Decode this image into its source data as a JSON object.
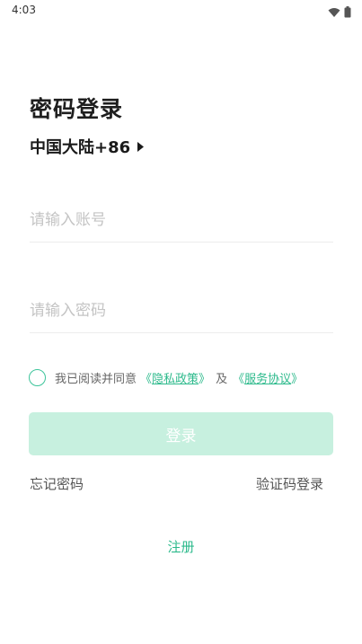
{
  "status_bar": {
    "time": "4:03",
    "icons": [
      "wifi-icon",
      "battery-icon"
    ]
  },
  "page": {
    "title": "密码登录",
    "region": "中国大陆+86"
  },
  "form": {
    "account_placeholder": "请输入账号",
    "password_placeholder": "请输入密码",
    "agreement": {
      "prefix": "我已阅读并同意",
      "privacy_open": "《",
      "privacy_label": "隐私政策",
      "privacy_close": "》",
      "and": "及",
      "service_open": "《",
      "service_label": "服务协议",
      "service_close": "》",
      "checked": false
    },
    "login_label": "登录"
  },
  "links": {
    "forgot_password": "忘记密码",
    "code_login": "验证码登录",
    "register": "注册"
  },
  "colors": {
    "accent": "#2dba8c",
    "button_disabled": "#c7f0df",
    "checkbox_border": "#3cc49a"
  }
}
